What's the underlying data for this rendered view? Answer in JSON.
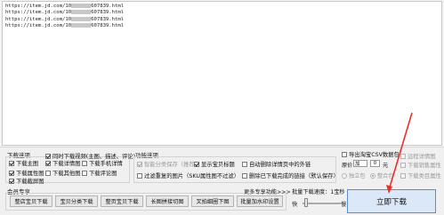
{
  "url_list": {
    "lines": [
      {
        "prefix": "https://item.jd.com/10",
        "suffix": "607839.html"
      },
      {
        "prefix": "https://item.jd.com/10",
        "suffix": "607839.html"
      },
      {
        "prefix": "https://item.jd.com/10",
        "suffix": "607839.html"
      },
      {
        "prefix": "https://item.jd.com/10",
        "suffix": "607839.html"
      }
    ]
  },
  "download_options": {
    "title": "下载选项",
    "items": [
      {
        "label": "下载主图",
        "checked": true
      },
      {
        "label": "同时下载视频(主图、描述、评论)",
        "checked": true
      },
      {
        "label": "下载属性图",
        "checked": true
      },
      {
        "label": "下载详情图",
        "checked": true
      },
      {
        "label": "下载手机详情",
        "checked": false
      },
      {
        "label": "下载截屏图",
        "checked": true
      },
      {
        "label": "下载其他图",
        "checked": false
      },
      {
        "label": "下载评论图",
        "checked": false
      }
    ]
  },
  "function_options": {
    "title": "功能选项",
    "items": [
      {
        "label": "智能分类保存（推荐）",
        "checked": true,
        "disabled": true
      },
      {
        "label": "显示宝贝标题",
        "checked": true
      },
      {
        "label": "自动删除详情页中的外链",
        "checked": false
      },
      {
        "label": "过滤重复的图片（SKU属性图不过滤）",
        "checked": false
      },
      {
        "label": "删除已下载完成的链接（默认保存）",
        "checked": false
      }
    ]
  },
  "right_options": {
    "export_csv": "导出淘宝CSV数据包",
    "remote_detail": "远程详情图",
    "price_label": "原价",
    "price_op": "加",
    "price_value": "0",
    "price_unit": "元",
    "attr_image": "下载销售属性",
    "zip_label": "独立包",
    "zip_selected": "整合包",
    "other_image": "下载类目属性"
  },
  "member": {
    "title": "会员专享",
    "buttons": [
      "整店宝贝下载",
      "宝贝分类下载",
      "整页宝贝下载",
      "长图拼接切图",
      "叉拍细圈下图",
      "批量加水印设置"
    ]
  },
  "more_features": "更多专享功能>>>",
  "speed": {
    "title": "批量下载速度：1宝秒",
    "fast": "快",
    "slow": "慢",
    "level": 0.05
  },
  "download_button": "立即下载",
  "colors": {
    "arrow": "#e8312b",
    "button_border": "#5a8fd0"
  }
}
